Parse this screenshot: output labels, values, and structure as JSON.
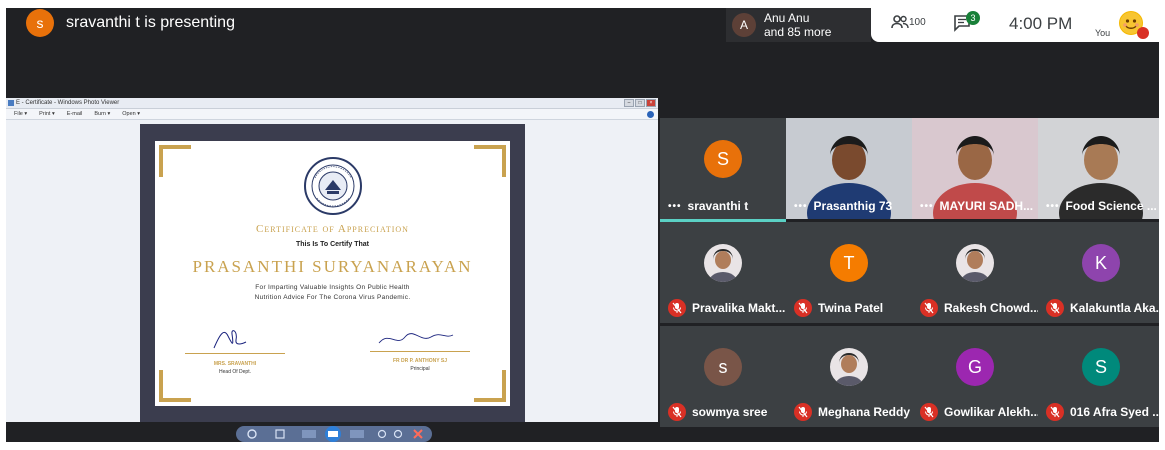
{
  "header": {
    "presenter_initial": "s",
    "presenter_text": "sravanthi t is presenting",
    "others_initial": "A",
    "others_line1": "Anu Anu",
    "others_line2": "and 85 more",
    "people_count": "100",
    "chat_badge": "3",
    "clock": "4:00 PM",
    "you_label": "You"
  },
  "photo_viewer": {
    "title": "E - Certificate - Windows Photo Viewer",
    "menu": [
      "File ▾",
      "Print ▾",
      "E-mail",
      "Burn ▾",
      "Open ▾"
    ]
  },
  "certificate": {
    "heading": "Certificate of Appreciation",
    "certify": "This Is To Certify That",
    "name": "PRASANTHI SURYANARAYAN",
    "line1": "For Imparting Valuable Insights On Public Health",
    "line2": "Nutrition Advice For The Corona Virus Pandemic.",
    "sig_left_name": "MRS. SRAVANTHI",
    "sig_left_title": "Head Of Dept.",
    "sig_right_name": "FR DR P. ANTHONY SJ",
    "sig_right_title": "Principal"
  },
  "participants": [
    {
      "name": "sravanthi t",
      "initial": "S",
      "color": "#e8710a",
      "kind": "avatar",
      "muted": false,
      "dots": true
    },
    {
      "name": "Prasanthig 73",
      "kind": "photo",
      "muted": false,
      "dots": true
    },
    {
      "name": "MAYURI SADH...",
      "kind": "photo",
      "muted": false,
      "dots": true
    },
    {
      "name": "Food Science ...",
      "kind": "photo",
      "muted": false,
      "dots": true
    },
    {
      "name": "Pravalika Makt...",
      "kind": "pic",
      "muted": true
    },
    {
      "name": "Twina Patel",
      "initial": "T",
      "color": "#f57c00",
      "kind": "avatar",
      "muted": true
    },
    {
      "name": "Rakesh Chowd...",
      "kind": "pic",
      "muted": true
    },
    {
      "name": "Kalakuntla Aka...",
      "initial": "K",
      "color": "#8e44ad",
      "kind": "avatar",
      "muted": true
    },
    {
      "name": "sowmya sree",
      "initial": "s",
      "color": "#795548",
      "kind": "avatar",
      "muted": true
    },
    {
      "name": "Meghana Reddy",
      "kind": "pic",
      "muted": true
    },
    {
      "name": "Gowlikar Alekh...",
      "initial": "G",
      "color": "#9c27b0",
      "kind": "avatar",
      "muted": true
    },
    {
      "name": "016 Afra Syed ...",
      "initial": "S",
      "color": "#00897b",
      "kind": "avatar",
      "muted": true
    }
  ]
}
